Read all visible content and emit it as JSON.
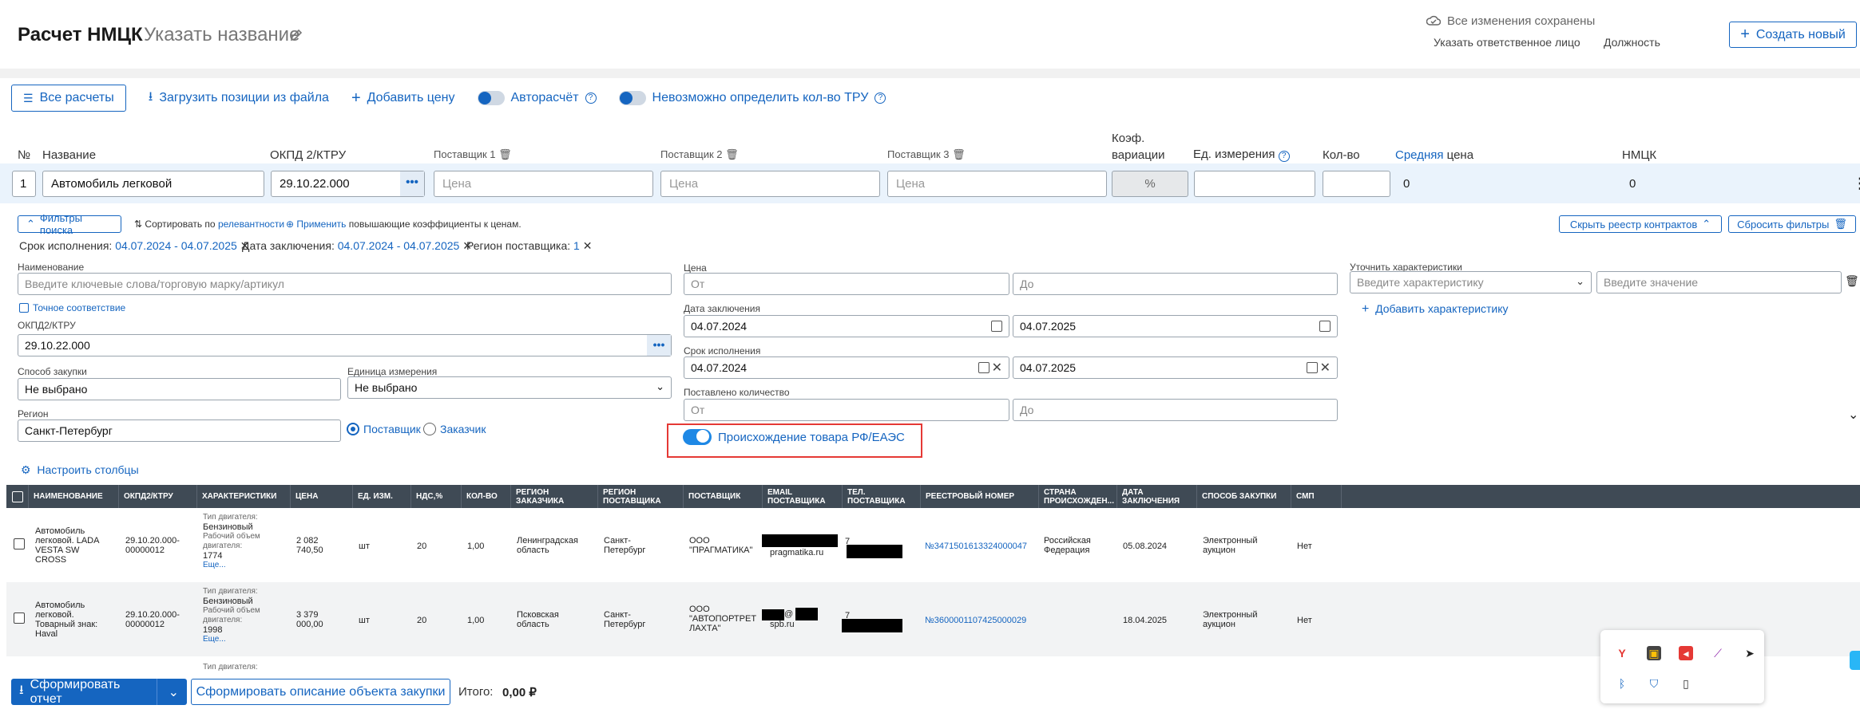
{
  "header": {
    "title": "Расчет НМЦК",
    "name_placeholder": "Указать название",
    "saved_status": "Все изменения сохранены",
    "responsible": "Указать ответственное лицо",
    "position": "Должность",
    "create_new": "Создать новый"
  },
  "toolbar": {
    "all_calculations": "Все расчеты",
    "upload": "Загрузить позиции из файла",
    "add_price": "Добавить цену",
    "autocalc": "Авторасчёт",
    "undefined_qty": "Невозможно определить кол-во ТРУ"
  },
  "columns": {
    "num": "№",
    "name": "Название",
    "okpd": "ОКПД 2/КТРУ",
    "supplier1": "Поставщик 1",
    "supplier2": "Поставщик 2",
    "supplier3": "Поставщик 3",
    "coef1": "Коэф.",
    "coef2": "вариации",
    "unit": "Ед. измерения",
    "qty": "Кол-во",
    "avg_a": "Средняя",
    "avg_b": "цена",
    "nmck": "НМЦК"
  },
  "row": {
    "num": "1",
    "name": "Автомобиль легковой",
    "okpd": "29.10.22.000",
    "price_placeholder": "Цена",
    "percent": "%",
    "avg": "0",
    "nmck": "0"
  },
  "filters": {
    "toggle": "Фильтры поиска",
    "sort_prefix": "Сортировать по",
    "sort_link": "релевантности",
    "apply_link": "Применить",
    "apply_suffix": "повышающие коэффициенты к ценам.",
    "hide_registry": "Скрыть реестр контрактов",
    "reset": "Сбросить фильтры",
    "chips": [
      {
        "label": "Срок исполнения:",
        "value": "04.07.2024 - 04.07.2025"
      },
      {
        "label": "Дата заключения:",
        "value": "04.07.2024 - 04.07.2025"
      },
      {
        "label": "Регион поставщика:",
        "value": "1"
      }
    ],
    "name_label": "Наименование",
    "name_placeholder": "Введите ключевые слова/торговую марку/артикул",
    "exact_match": "Точное соответствие",
    "okpd_label": "ОКПД2/КТРУ",
    "okpd_value": "29.10.22.000",
    "method_label": "Способ закупки",
    "method_value": "Не выбрано",
    "unit_label": "Единица измерения",
    "unit_value": "Не выбрано",
    "region_label": "Регион",
    "region_value": "Санкт-Петербург",
    "supplier_radio": "Поставщик",
    "customer_radio": "Заказчик",
    "price_label": "Цена",
    "from": "От",
    "to": "До",
    "date_label": "Дата заключения",
    "date_from": "04.07.2024",
    "date_to": "04.07.2025",
    "term_label": "Срок исполнения",
    "term_from": "04.07.2024",
    "term_to": "04.07.2025",
    "delivered_label": "Поставлено количество",
    "origin": "Происхождение товара РФ/ЕАЭС",
    "char_label": "Уточнить характеристики",
    "char_placeholder": "Введите характеристику",
    "value_placeholder": "Введите значение",
    "add_char": "Добавить характеристику"
  },
  "configure_columns": "Настроить столбцы",
  "table": {
    "headers": [
      "Наименование",
      "ОКПД2/КТРУ",
      "Характеристики",
      "Цена",
      "Ед. изм.",
      "НДС,%",
      "Кол-во",
      "Регион заказчика",
      "Регион поставщика",
      "Поставщик",
      "Email поставщика",
      "Тел. поставщика",
      "Реестровый номер",
      "Страна происхожден...",
      "Дата заключения",
      "Способ закупки",
      "СМП"
    ],
    "rows": [
      {
        "name": [
          "Автомобиль",
          "легковой. LADA",
          "VESTA SW",
          "CROSS"
        ],
        "okpd": [
          "29.10.20.000-",
          "00000012"
        ],
        "char_type_label": "Тип двигателя:",
        "char_type": "Бензиновый",
        "char_vol_label": [
          "Рабочий объем",
          "двигателя:"
        ],
        "char_vol": "1774",
        "more": "Еще...",
        "price": [
          "2 082",
          "740,50"
        ],
        "unit": "шт",
        "vat": "20",
        "qty": "1,00",
        "cust_region": [
          "Ленинградская",
          "область"
        ],
        "supp_region": [
          "Санкт-",
          "Петербург"
        ],
        "supplier": [
          "ООО",
          "\"ПРАГМАТИКА\""
        ],
        "email": "pragmatika.ru",
        "phone": "7",
        "reg_no": "№3471501613324000047",
        "country": [
          "Российская",
          "Федерация"
        ],
        "date": "05.08.2024",
        "method": [
          "Электронный",
          "аукцион"
        ],
        "smp": "Нет"
      },
      {
        "name": [
          "Автомобиль",
          "легковой.",
          "Товарный знак:",
          "Haval"
        ],
        "okpd": [
          "29.10.20.000-",
          "00000012"
        ],
        "char_type_label": "Тип двигателя:",
        "char_type": "Бензиновый",
        "char_vol_label": [
          "Рабочий объем",
          "двигателя:"
        ],
        "char_vol": "1998",
        "more": "Еще...",
        "price": [
          "3 379",
          "000,00"
        ],
        "unit": "шт",
        "vat": "20",
        "qty": "1,00",
        "cust_region": [
          "Псковская",
          "область"
        ],
        "supp_region": [
          "Санкт-",
          "Петербург"
        ],
        "supplier": [
          "ООО",
          "\"АВТОПОРТРЕТ",
          "ЛАХТА\""
        ],
        "email": "spb.ru",
        "email_at": "@",
        "phone": "7",
        "reg_no": "№3600001107425000029",
        "country": [
          "",
          ""
        ],
        "date": "18.04.2025",
        "method": [
          "Электронный",
          "аукцион"
        ],
        "smp": "Нет"
      }
    ],
    "partial_label": "Тип двигателя:"
  },
  "bottom": {
    "report": "Сформировать отчет",
    "describe": "Сформировать описание объекта закупки",
    "total_label": "Итого:",
    "total_value": "0,00 ₽"
  },
  "colors": {
    "accent": "#1565c0",
    "highlight_border": "#e53935",
    "row_bg": "#eaf3fc",
    "table_header": "#3f4a55"
  }
}
